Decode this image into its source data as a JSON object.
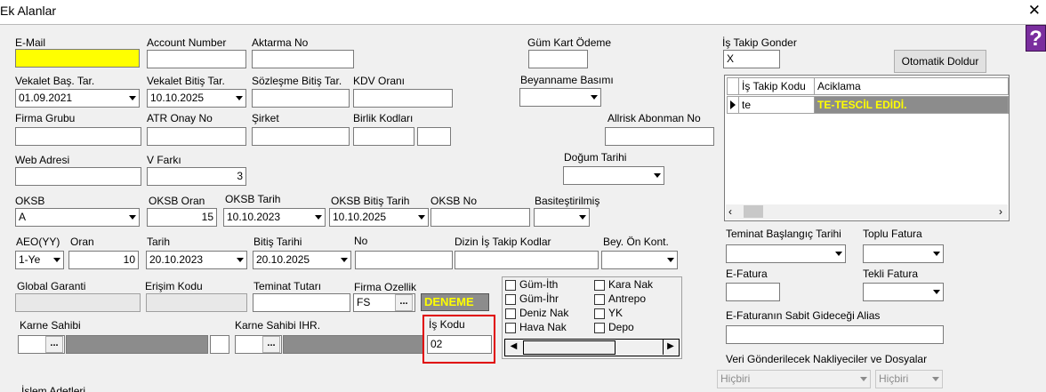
{
  "window": {
    "title": "Ek Alanlar",
    "close_glyph": "✕",
    "help_glyph": "?"
  },
  "fields": {
    "email": {
      "label": "E-Mail",
      "value": ""
    },
    "account_number": {
      "label": "Account Number",
      "value": ""
    },
    "aktarma_no": {
      "label": "Aktarma No",
      "value": ""
    },
    "gum_kart_odeme": {
      "label": "Güm Kart Ödeme",
      "value": ""
    },
    "is_takip_gonder": {
      "label": "İş Takip Gonder",
      "value": "X"
    },
    "vekalet_bas": {
      "label": "Vekalet Baş. Tar.",
      "value": "01.09.2021"
    },
    "vekalet_bitis": {
      "label": "Vekalet Bitiş Tar.",
      "value": "10.10.2025"
    },
    "sozlesme_bitis": {
      "label": "Sözleşme Bitiş Tar.",
      "value": ""
    },
    "kdv_orani": {
      "label": "KDV Oranı",
      "value": ""
    },
    "beyanname_basimi": {
      "label": "Beyanname Basımı",
      "value": ""
    },
    "firma_grubu": {
      "label": "Firma Grubu",
      "value": ""
    },
    "atr_onay_no": {
      "label": "ATR Onay No",
      "value": ""
    },
    "sirket": {
      "label": "Şirket",
      "value": ""
    },
    "birlik_kodlari": {
      "label": "Birlik Kodları",
      "value": ""
    },
    "allrisk": {
      "label": "Allrisk Abonman No",
      "value": ""
    },
    "web_adresi": {
      "label": "Web Adresi",
      "value": ""
    },
    "v_farki": {
      "label": "V Farkı",
      "value": "3"
    },
    "dogum_tarihi": {
      "label": "Doğum Tarihi",
      "value": ""
    },
    "oksb": {
      "label": "OKSB",
      "value": "A"
    },
    "oksb_oran": {
      "label": "OKSB Oran",
      "value": "15"
    },
    "oksb_tarih": {
      "label": "OKSB Tarih",
      "value": "10.10.2023"
    },
    "oksb_bitis": {
      "label": "OKSB Bitiş Tarih",
      "value": "10.10.2025"
    },
    "oksb_no": {
      "label": "OKSB No",
      "value": ""
    },
    "basitestirilmis": {
      "label": "Basiteştirilmiş",
      "value": ""
    },
    "aeo": {
      "label": "AEO(YY)",
      "value": "1-Ye"
    },
    "oran": {
      "label": "Oran",
      "value": "10"
    },
    "tarih": {
      "label": "Tarih",
      "value": "20.10.2023"
    },
    "bitis_tarihi": {
      "label": "Bitiş Tarihi",
      "value": "20.10.2025"
    },
    "no": {
      "label": "No",
      "value": ""
    },
    "dizin_is_takip": {
      "label": "Dizin İş Takip Kodlar",
      "value": ""
    },
    "bey_on_kont": {
      "label": "Bey. Ön Kont.",
      "value": ""
    },
    "global_garanti": {
      "label": "Global Garanti",
      "value": ""
    },
    "erisim_kodu": {
      "label": "Erişim Kodu",
      "value": ""
    },
    "teminat_tutari": {
      "label": "Teminat Tutarı",
      "value": ""
    },
    "firma_ozellik": {
      "label": "Firma Ozellik",
      "value": "FS",
      "badge": "DENEME"
    },
    "karne_sahibi": {
      "label": "Karne Sahibi",
      "value": ""
    },
    "karne_sahibi_ihr": {
      "label": "Karne Sahibi IHR.",
      "value": ""
    },
    "is_kodu": {
      "label": "İş Kodu",
      "value": "02"
    },
    "islem_adetleri": {
      "label": "İşlem Adetleri"
    },
    "teminat_baslangic": {
      "label": "Teminat Başlangıç Tarihi",
      "value": ""
    },
    "toplu_fatura": {
      "label": "Toplu Fatura",
      "value": ""
    },
    "e_fatura": {
      "label": "E-Fatura",
      "value": ""
    },
    "tekli_fatura": {
      "label": "Tekli Fatura",
      "value": ""
    },
    "e_fatura_alias": {
      "label": "E-Faturanın Sabit Gideceği Alias",
      "value": ""
    },
    "veri_gonderilecek": {
      "label": "Veri Gönderilecek Nakliyeciler ve Dosyalar",
      "opt1": "Hiçbiri",
      "opt2": "Hiçbiri"
    }
  },
  "buttons": {
    "otomatik_doldur": "Otomatik Doldur",
    "ellipsis": "..."
  },
  "grid": {
    "columns": [
      "İş Takip Kodu",
      "Aciklama"
    ],
    "rows": [
      {
        "code": "te",
        "desc": "TE-TESCİL EDİDİ."
      }
    ]
  },
  "checkboxes": [
    {
      "label": "Güm-İth",
      "checked": false
    },
    {
      "label": "Kara Nak",
      "checked": false
    },
    {
      "label": "Güm-İhr",
      "checked": false
    },
    {
      "label": "Antrepo",
      "checked": false
    },
    {
      "label": "Deniz Nak",
      "checked": false
    },
    {
      "label": "YK",
      "checked": false
    },
    {
      "label": "Hava Nak",
      "checked": false
    },
    {
      "label": "Depo",
      "checked": false
    }
  ],
  "colors": {
    "highlight_yellow": "#ffff00",
    "badge_bg": "#8c8c8c",
    "red_highlight": "#e00000",
    "grid_row_bg": "#8c8c8c",
    "help_purple": "#7a2e9e"
  }
}
